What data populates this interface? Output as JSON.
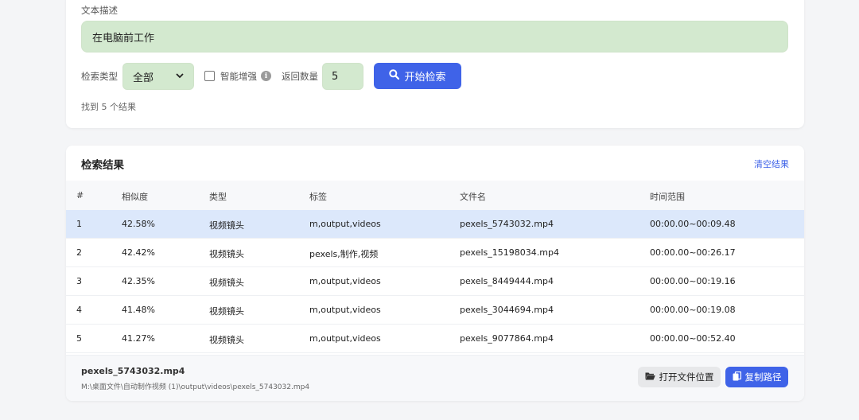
{
  "search": {
    "text_label": "文本描述",
    "text_value": "在电脑前工作",
    "type_label": "检索类型",
    "type_value": "全部",
    "enhance_label": "智能增强",
    "count_label": "返回数量",
    "count_value": "5",
    "search_button": "开始检索",
    "found_text": "找到 5 个结果"
  },
  "results": {
    "title": "检索结果",
    "clear_link": "清空结果",
    "columns": [
      "#",
      "相似度",
      "类型",
      "标签",
      "文件名",
      "时间范围"
    ],
    "rows": [
      {
        "n": "1",
        "sim": "42.58%",
        "type": "视频镜头",
        "tags": "m,output,videos",
        "file": "pexels_5743032.mp4",
        "range": "00:00.00~00:09.48"
      },
      {
        "n": "2",
        "sim": "42.42%",
        "type": "视频镜头",
        "tags": "pexels,制作,视频",
        "file": "pexels_15198034.mp4",
        "range": "00:00.00~00:26.17"
      },
      {
        "n": "3",
        "sim": "42.35%",
        "type": "视频镜头",
        "tags": "m,output,videos",
        "file": "pexels_8449444.mp4",
        "range": "00:00.00~00:19.16"
      },
      {
        "n": "4",
        "sim": "41.48%",
        "type": "视频镜头",
        "tags": "m,output,videos",
        "file": "pexels_3044694.mp4",
        "range": "00:00.00~00:19.08"
      },
      {
        "n": "5",
        "sim": "41.27%",
        "type": "视频镜头",
        "tags": "m,output,videos",
        "file": "pexels_9077864.mp4",
        "range": "00:00.00~00:52.40"
      }
    ]
  },
  "detail": {
    "file_name": "pexels_5743032.mp4",
    "file_path": "M:\\桌面文件\\自动制作视频 (1)\\output\\videos\\pexels_5743032.mp4",
    "open_button": "打开文件位置",
    "copy_button": "复制路径"
  },
  "colors": {
    "accent": "#3f63e8",
    "input_bg": "#d3e9cf",
    "selected_row": "#dce8fb"
  }
}
